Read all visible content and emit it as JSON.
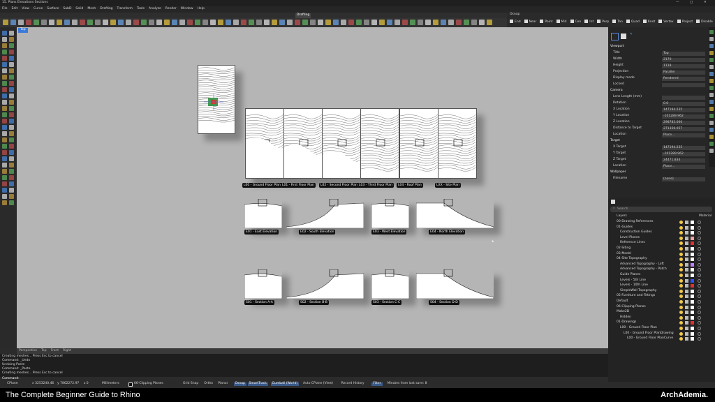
{
  "window_title": "15. Plans Elevations Sections",
  "menu": [
    "File",
    "Edit",
    "View",
    "Curve",
    "Surface",
    "SubD",
    "Solid",
    "Mesh",
    "Drafting",
    "Transform",
    "Tools",
    "Analyze",
    "Render",
    "Window",
    "Help"
  ],
  "toolbar_active_tab": "Drafting",
  "osnap": {
    "tab1": "Osnap",
    "items": [
      "End",
      "Near",
      "Point",
      "Mid",
      "Cen",
      "Int",
      "Perp",
      "Tan",
      "Quad",
      "Knot",
      "Vertex",
      "Project",
      "Disable"
    ]
  },
  "viewport": {
    "name": "Top",
    "plan_labels": [
      "L00 - Ground Floor Plan",
      "L01 - First Floor Plan",
      "L02 - Second Floor Plan",
      "L03 - Third Floor Plan",
      "L04 - Roof Plan",
      "LXX - Site Plan"
    ],
    "elevation_labels": [
      "E01 - East Elevation",
      "E02 - South Elevation",
      "E03 - West Elevation",
      "E04 - North Elevation"
    ],
    "section_labels": [
      "S01 - Section A-A",
      "S02 - Section B-B",
      "S03 - Section C-C",
      "S04 - Section D-D"
    ],
    "bottom_tabs": [
      "Perspective",
      "Top",
      "Front",
      "Right"
    ]
  },
  "command_history": [
    "Creating meshes... Press Esc to cancel",
    "Command: _Undo",
    "Undoing Paste",
    "Command: _Paste",
    "Creating meshes... Press Esc to cancel"
  ],
  "command_prompt": "Command:",
  "status_bar": {
    "cplane": "CPlane",
    "x": "x 3253240.46",
    "y": "y 7862272.97",
    "z": "z 0",
    "units": "Millimeters",
    "layer": "06-Clipping Planes",
    "items": [
      "Grid Snap",
      "Ortho",
      "Planar",
      "Osnap",
      "SmartTrack",
      "Gumball (World)",
      "Auto CPlane (View)",
      "Record History",
      "Filter",
      "Minutes from last save: 8"
    ]
  },
  "properties": {
    "viewport_header": "Viewport",
    "viewport_rows": [
      {
        "label": "Title",
        "value": "Top"
      },
      {
        "label": "Width",
        "value": "2170"
      },
      {
        "label": "Height",
        "value": "1118"
      },
      {
        "label": "Projection",
        "value": "Parallel"
      },
      {
        "label": "Display mode",
        "value": "Rendered"
      },
      {
        "label": "Locked",
        "value": ""
      }
    ],
    "camera_header": "Camera",
    "camera_rows": [
      {
        "label": "Lens Length (mm)",
        "value": ""
      },
      {
        "label": "Rotation",
        "value": "0.0"
      },
      {
        "label": "X Location",
        "value": "147194.235"
      },
      {
        "label": "Y Location",
        "value": "-101289.962"
      },
      {
        "label": "Z Location",
        "value": "298783.000"
      },
      {
        "label": "Distance to Target",
        "value": "271356.057"
      },
      {
        "label": "Location",
        "value": "Place..."
      }
    ],
    "target_header": "Target",
    "target_rows": [
      {
        "label": "X Target",
        "value": "147194.235"
      },
      {
        "label": "Y Target",
        "value": "-101289.962"
      },
      {
        "label": "Z Target",
        "value": "24471.834"
      },
      {
        "label": "Location",
        "value": "Place..."
      }
    ],
    "wallpaper_header": "Wallpaper",
    "wallpaper_rows": [
      {
        "label": "Filename",
        "value": "(none)"
      }
    ]
  },
  "layers": {
    "search_placeholder": "Search",
    "col_layers": "Layers",
    "col_material": "Material",
    "rows": [
      {
        "name": "00-Drawing References",
        "indent": 0,
        "color": "#ffffff"
      },
      {
        "name": "01-Guides",
        "indent": 0,
        "color": "#ffffff"
      },
      {
        "name": "Construction Guides",
        "indent": 1,
        "color": "#ffffff"
      },
      {
        "name": "Level Planes",
        "indent": 1,
        "color": "#f0a0a0"
      },
      {
        "name": "Reference Lines",
        "indent": 1,
        "color": "#e03030"
      },
      {
        "name": "02-Siting",
        "indent": 0,
        "color": "#ffffff"
      },
      {
        "name": "03-Model",
        "indent": 0,
        "color": "#ffffff"
      },
      {
        "name": "04-Site Topography",
        "indent": 0,
        "color": "#ffffff"
      },
      {
        "name": "Advanced Topography - Loft",
        "indent": 1,
        "color": "#c080ff"
      },
      {
        "name": "Advanced Topography - Patch",
        "indent": 1,
        "color": "#ffffff"
      },
      {
        "name": "Guide Planes",
        "indent": 1,
        "color": "#ffffff"
      },
      {
        "name": "Levels - 5th Line",
        "indent": 1,
        "color": "#3050ff"
      },
      {
        "name": "Levels - 10th Line",
        "indent": 1,
        "color": "#e03030"
      },
      {
        "name": "SimpleWall Topography",
        "indent": 1,
        "color": "#ffffff"
      },
      {
        "name": "05-Furniture and Fittings",
        "indent": 0,
        "color": "#ffffff"
      },
      {
        "name": "Default",
        "indent": 0,
        "color": "#ffffff"
      },
      {
        "name": "06-Clipping Planes",
        "indent": 0,
        "color": "#ffffff"
      },
      {
        "name": "Make2D",
        "indent": 0,
        "color": "#ffffff"
      },
      {
        "name": "Hidden",
        "indent": 1,
        "color": "#ffffff"
      },
      {
        "name": "01-Drawings",
        "indent": 0,
        "color": "#e03030"
      },
      {
        "name": "L00 - Ground Floor Plan",
        "indent": 1,
        "color": "#ffffff"
      },
      {
        "name": "L00 - Ground Floor PlanDrawing",
        "indent": 2,
        "color": "#ffffff"
      },
      {
        "name": "L00 - Ground Floor PlanCurve",
        "indent": 3,
        "color": "#ffffff"
      }
    ]
  },
  "footer": {
    "course_title": "The Complete Beginner Guide to Rhino",
    "brand": "ArchAdemia."
  }
}
